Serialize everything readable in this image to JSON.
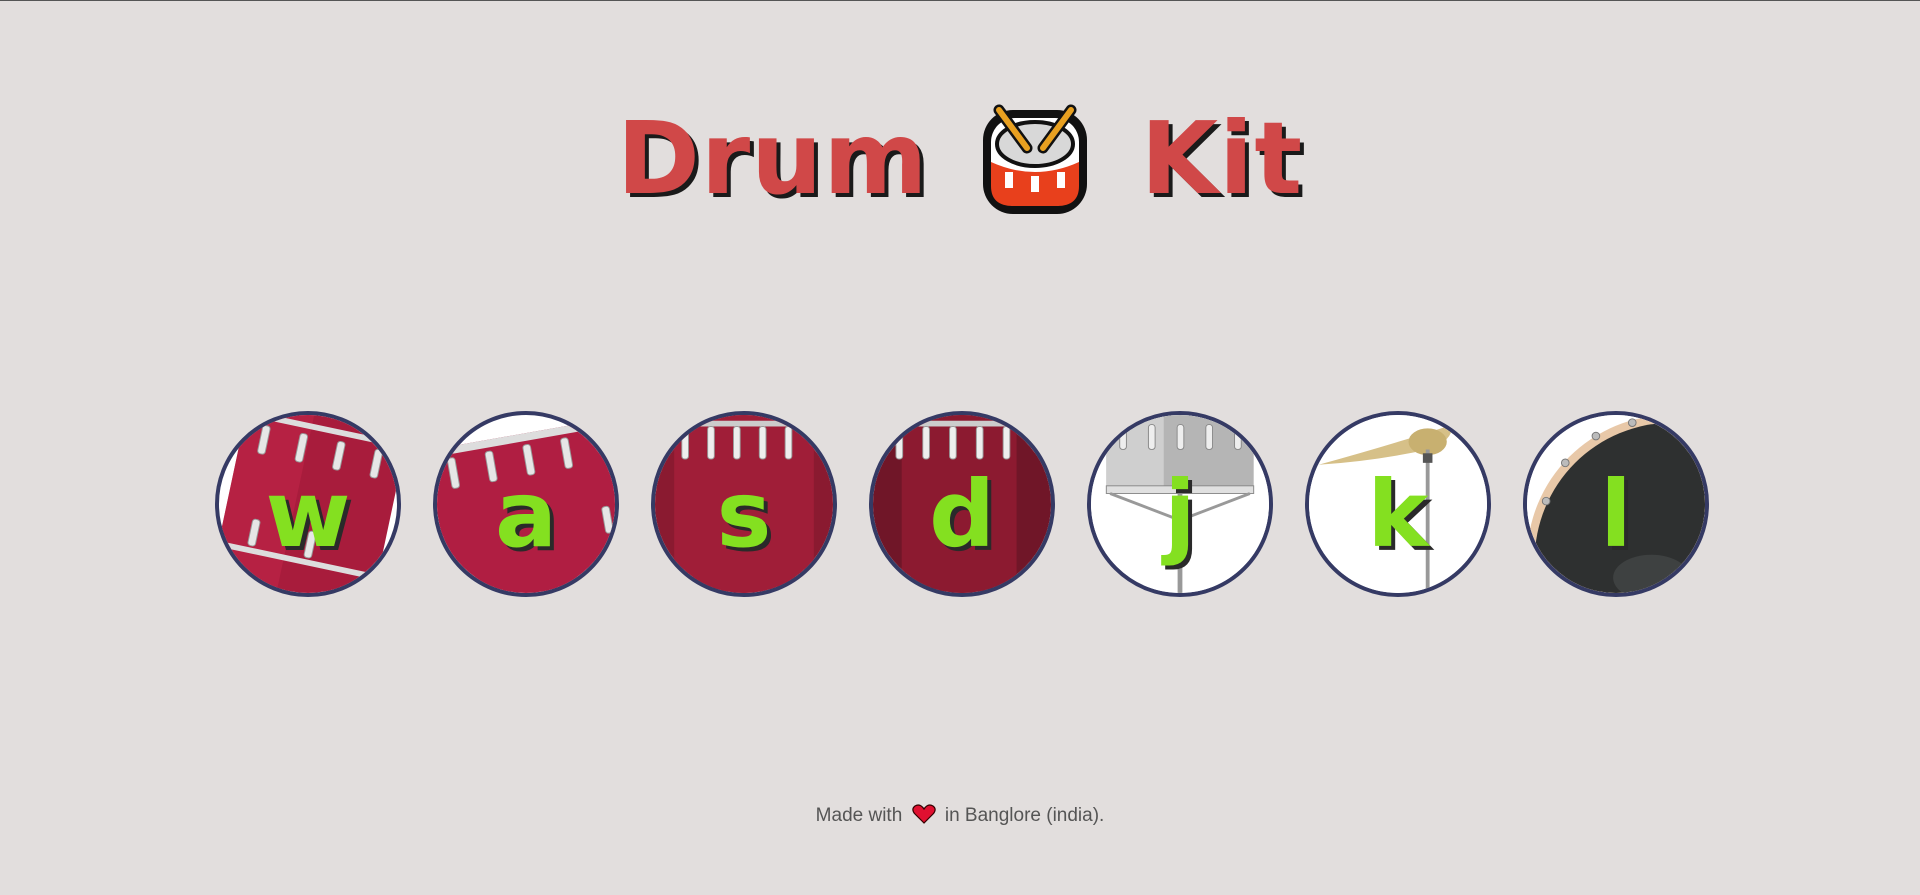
{
  "header": {
    "title_left": "Drum",
    "title_right": "Kit",
    "emoji_icon": "drum-icon"
  },
  "drums": [
    {
      "key": "w",
      "type": "tom-tilted"
    },
    {
      "key": "a",
      "type": "tom-tilted"
    },
    {
      "key": "s",
      "type": "tom-front"
    },
    {
      "key": "d",
      "type": "tom-front"
    },
    {
      "key": "j",
      "type": "snare"
    },
    {
      "key": "k",
      "type": "crash"
    },
    {
      "key": "l",
      "type": "kick"
    }
  ],
  "footer": {
    "prefix": "Made with",
    "suffix": "in Banglore (india).",
    "icon": "heart-icon"
  },
  "colors": {
    "background": "#e2dedd",
    "title": "#d04848",
    "key": "#84e020",
    "ring": "#353a64"
  }
}
